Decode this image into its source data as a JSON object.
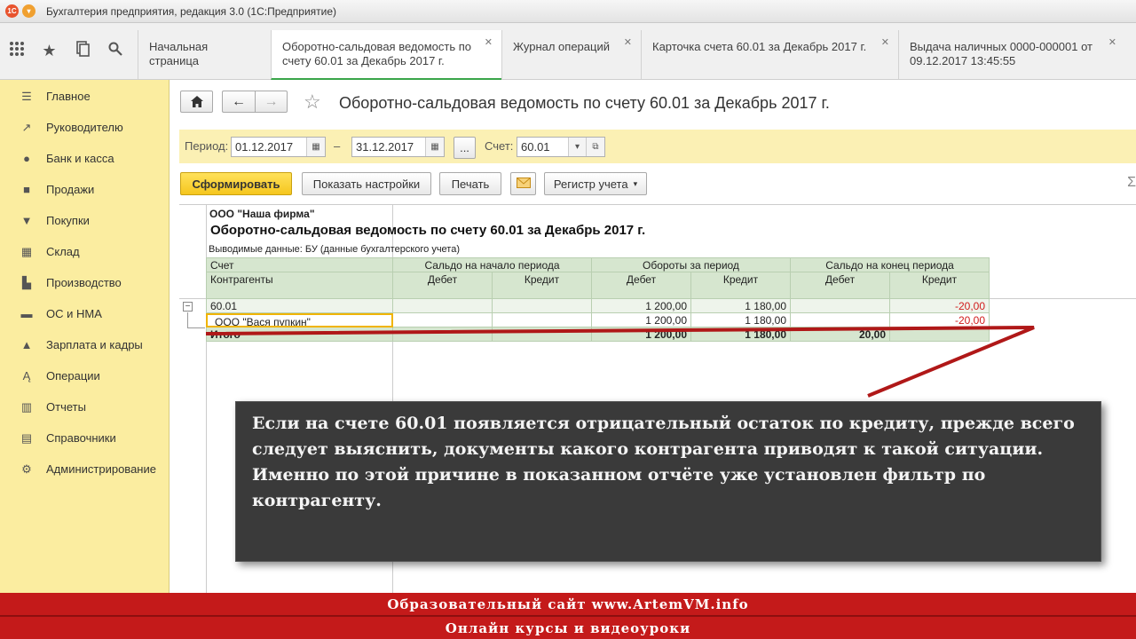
{
  "window": {
    "title": "Бухгалтерия предприятия, редакция 3.0  (1С:Предприятие)",
    "logo_text": "1С"
  },
  "tabs": [
    {
      "label": "Начальная страница",
      "active": false,
      "closable": false
    },
    {
      "label": "Оборотно-сальдовая ведомость по счету 60.01 за Декабрь 2017 г.",
      "active": true,
      "closable": true
    },
    {
      "label": "Журнал операций",
      "active": false,
      "closable": true
    },
    {
      "label": "Карточка счета 60.01 за Декабрь 2017 г.",
      "active": false,
      "closable": true
    },
    {
      "label": "Выдача наличных 0000-000001 от 09.12.2017 13:45:55",
      "active": false,
      "closable": true
    }
  ],
  "toolbar_icons": [
    "apps-grid-icon",
    "favorites-star-icon",
    "history-icon",
    "search-icon"
  ],
  "sidebar": {
    "items": [
      {
        "label": "Главное",
        "icon": "menu-lines-icon"
      },
      {
        "label": "Руководителю",
        "icon": "trend-icon"
      },
      {
        "label": "Банк и касса",
        "icon": "ruble-coin-icon"
      },
      {
        "label": "Продажи",
        "icon": "bag-icon"
      },
      {
        "label": "Покупки",
        "icon": "cart-icon"
      },
      {
        "label": "Склад",
        "icon": "warehouse-icon"
      },
      {
        "label": "Производство",
        "icon": "factory-icon"
      },
      {
        "label": "ОС и НМА",
        "icon": "assets-icon"
      },
      {
        "label": "Зарплата и кадры",
        "icon": "people-icon"
      },
      {
        "label": "Операции",
        "icon": "operations-icon"
      },
      {
        "label": "Отчеты",
        "icon": "reports-icon"
      },
      {
        "label": "Справочники",
        "icon": "catalogs-icon"
      },
      {
        "label": "Администрирование",
        "icon": "gear-icon"
      }
    ]
  },
  "page": {
    "title": "Оборотно-сальдовая ведомость по счету 60.01 за Декабрь 2017 г."
  },
  "filters": {
    "period_label": "Период:",
    "date_from": "01.12.2017",
    "dash": "–",
    "date_to": "31.12.2017",
    "more": "...",
    "account_label": "Счет:",
    "account_value": "60.01"
  },
  "actions": {
    "generate": "Сформировать",
    "show_settings": "Показать настройки",
    "print": "Печать",
    "register": "Регистр учета",
    "sigma": "Σ"
  },
  "report": {
    "company": "ООО \"Наша фирма\"",
    "title": "Оборотно-сальдовая ведомость по счету 60.01 за Декабрь 2017 г.",
    "subtitle": "Выводимые данные:  БУ (данные бухгалтерского учета)",
    "headers": {
      "account": "Счет",
      "counterparties": "Контрагенты",
      "opening": "Сальдо на начало периода",
      "turnover": "Обороты за период",
      "closing": "Сальдо на конец периода",
      "debit": "Дебет",
      "credit": "Кредит"
    },
    "rows": [
      {
        "name": "60.01",
        "open_d": "",
        "open_c": "",
        "turn_d": "1 200,00",
        "turn_c": "1 180,00",
        "close_d": "",
        "close_c": "-20,00"
      },
      {
        "name": "ООО \"Вася пупкин\"",
        "open_d": "",
        "open_c": "",
        "turn_d": "1 200,00",
        "turn_c": "1 180,00",
        "close_d": "",
        "close_c": "-20,00"
      },
      {
        "name": "Итого",
        "open_d": "",
        "open_c": "",
        "turn_d": "1 200,00",
        "turn_c": "1 180,00",
        "close_d": "20,00",
        "close_c": ""
      }
    ]
  },
  "note": {
    "text1": "Если на счете 60.01 появляется отрицательный остаток по кредиту, прежде всего следует выяснить, документы какого контрагента приводят к такой ситуации.",
    "text2": "Именно по этой причине в показанном отчёте уже установлен фильтр по контрагенту."
  },
  "footer": {
    "line1": "Образовательный сайт www.ArtemVM.info",
    "line2": "Онлайн курсы и видеоуроки"
  },
  "colors": {
    "accent_yellow": "#fbeda0",
    "primary_button": "#f5c61e",
    "negative": "#d11c1c",
    "footer": "#c41a1a"
  }
}
